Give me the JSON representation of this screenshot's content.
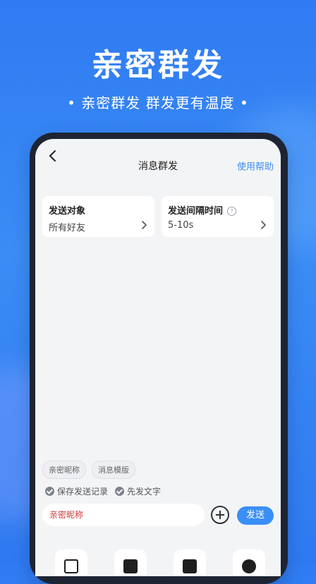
{
  "hero": {
    "title": "亲密群发",
    "subtitle": "• 亲密群发  群发更有温度 •"
  },
  "navbar": {
    "title": "消息群发",
    "help_label": "使用帮助"
  },
  "target_card": {
    "label": "发送对象",
    "value": "所有好友"
  },
  "interval_card": {
    "label": "发送间隔时间",
    "value": "5-10s"
  },
  "chips": [
    "亲密昵称",
    "消息模版"
  ],
  "options": [
    "保存发送记录",
    "先发文字"
  ],
  "composer": {
    "input_value": "亲密昵称",
    "send_label": "发送"
  },
  "icons": {
    "back": "chevron-left-icon",
    "chevron": "chevron-right-icon",
    "help": "question-circle-icon",
    "check": "check-circle-icon",
    "plus": "plus-circle-icon"
  },
  "colors": {
    "accent": "#3a8ff5",
    "background_gradient_top": "#2f7bf2",
    "nickname_text": "#d03a3a"
  }
}
